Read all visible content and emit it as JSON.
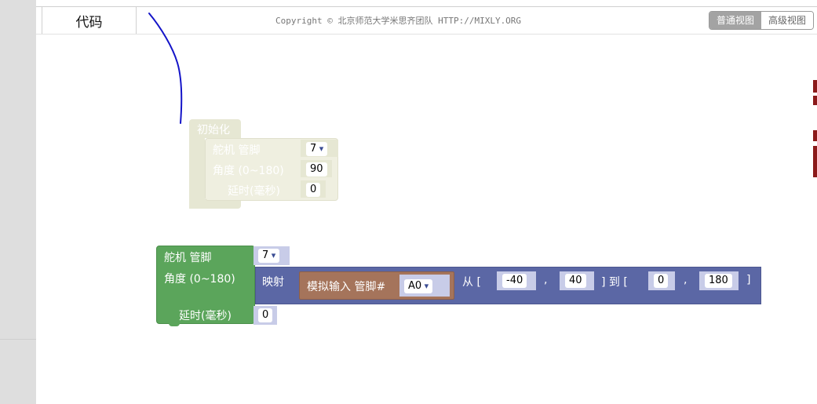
{
  "header": {
    "code_tab": "代码",
    "copyright": "Copyright © 北京师范大学米思齐团队 HTTP://MIXLY.ORG",
    "views": [
      "普通视图",
      "高级视图"
    ]
  },
  "faded_block": {
    "title": "初始化",
    "servo_label": "舵机 管脚",
    "servo_pin": "7",
    "angle_label": "角度 (0~180)",
    "angle_value": "90",
    "delay_label": "延时(毫秒)",
    "delay_value": "0"
  },
  "servo_block": {
    "servo_label": "舵机 管脚",
    "servo_pin": "7",
    "angle_label": "角度 (0~180)",
    "delay_label": "延时(毫秒)",
    "delay_value": "0"
  },
  "map_block": {
    "label": "映射",
    "from_label": "从 [",
    "from_low": "-40",
    "comma1": ",",
    "from_high": "40",
    "to_label": "] 到 [",
    "to_low": "0",
    "comma2": ",",
    "to_high": "180",
    "close": "]"
  },
  "analog_block": {
    "label": "模拟输入 管脚#",
    "pin": "A0"
  },
  "colors": {
    "servo_green": "#5ba55b",
    "map_blue": "#5b67a5",
    "analog_brown": "#a5745b",
    "faded": "#e6e7d3",
    "socket": "#c8cce8"
  }
}
